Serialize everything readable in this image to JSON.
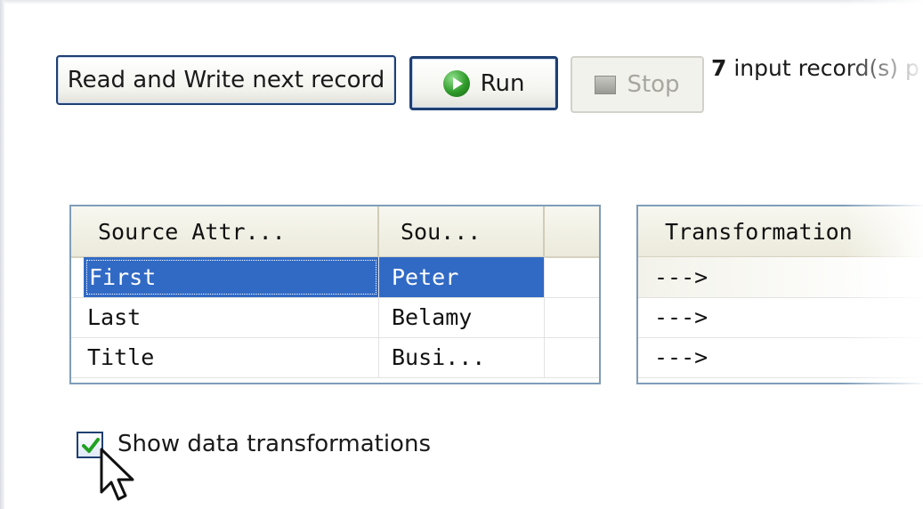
{
  "toolbar": {
    "read_write_label": "Read and Write next record",
    "run_label": "Run",
    "stop_label": "Stop",
    "status_count": "7",
    "status_text": " input record(s) p"
  },
  "source_table": {
    "columns": [
      "Source Attr...",
      "Sou..."
    ],
    "rows": [
      {
        "attr": "First",
        "value": "Peter",
        "selected": true
      },
      {
        "attr": "Last",
        "value": "Belamy",
        "selected": false
      },
      {
        "attr": "Title",
        "value": "Busi...",
        "selected": false
      }
    ]
  },
  "transformation_table": {
    "columns": [
      "Transformation"
    ],
    "rows": [
      "--->",
      "--->",
      "--->"
    ]
  },
  "options": {
    "show_transformations_label": "Show data transformations",
    "show_transformations_checked": true
  },
  "icons": {
    "run": "play-circle-icon",
    "stop": "stop-square-icon",
    "check": "checkmark-icon",
    "cursor": "mouse-pointer-icon"
  },
  "colors": {
    "selection": "#316ac5",
    "button_border": "#1f3f72",
    "grid_border": "#7f9db9",
    "header_bg": "#ebeadb",
    "run_icon_green": "#2f9a2a"
  }
}
